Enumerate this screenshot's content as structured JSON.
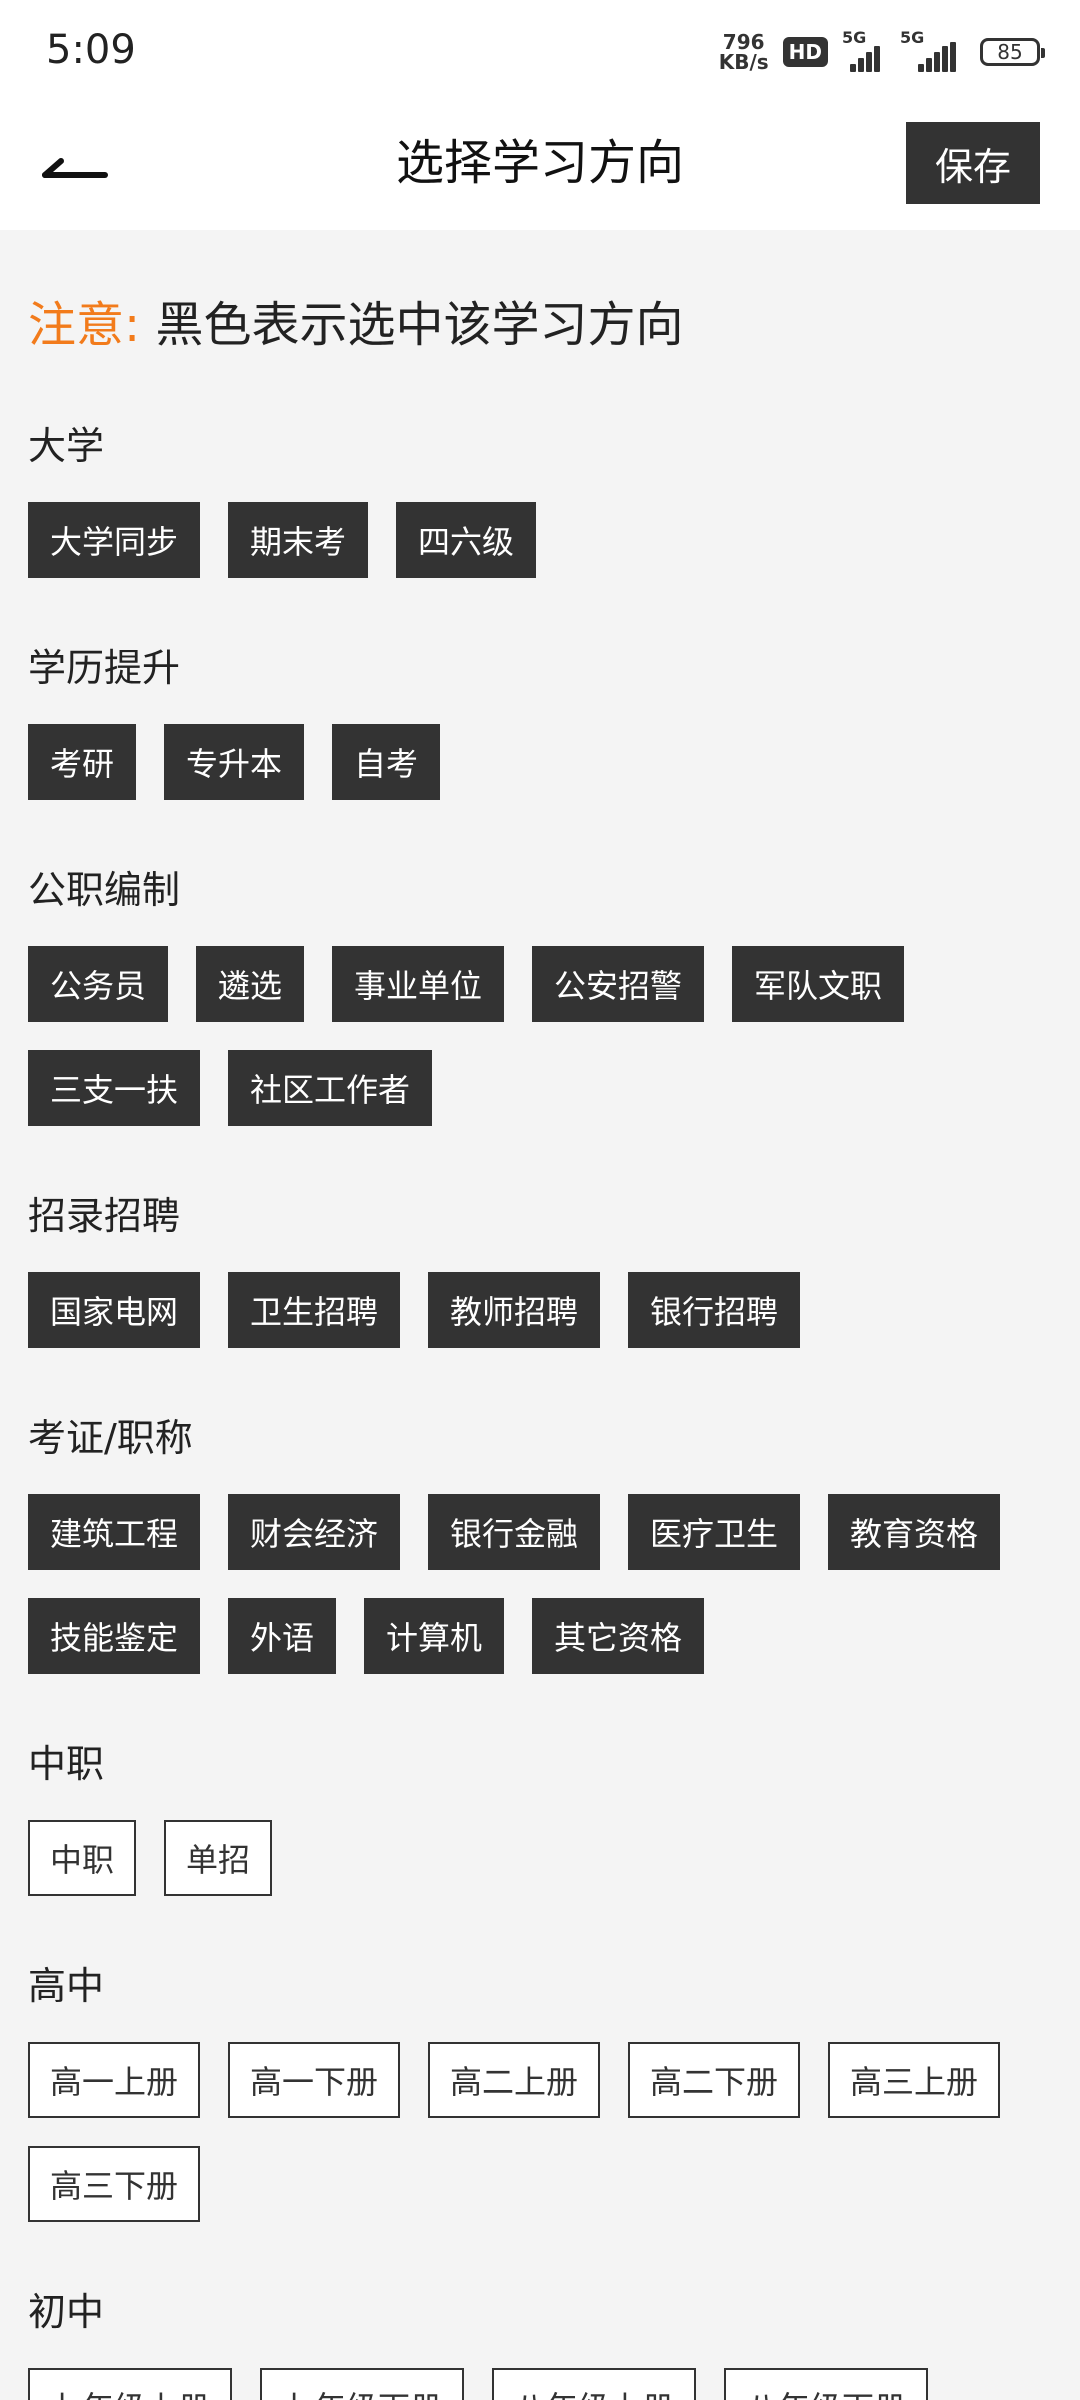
{
  "status": {
    "time": "5:09",
    "net_speed_value": "796",
    "net_speed_unit": "KB/s",
    "hd": "HD",
    "signal1_label": "5G",
    "signal2_label": "5G",
    "battery": "85"
  },
  "header": {
    "title": "选择学习方向",
    "save_label": "保存"
  },
  "notice": {
    "label": "注意:",
    "text": "黑色表示选中该学习方向"
  },
  "colors": {
    "selected_bg": "#333333",
    "selected_text": "#ffffff",
    "unselected_bg": "#ffffff",
    "accent": "#f27b1b",
    "page_bg": "#f4f4f4"
  },
  "sections": [
    {
      "title": "大学",
      "chips": [
        {
          "label": "大学同步",
          "selected": true
        },
        {
          "label": "期末考",
          "selected": true
        },
        {
          "label": "四六级",
          "selected": true
        }
      ]
    },
    {
      "title": "学历提升",
      "chips": [
        {
          "label": "考研",
          "selected": true
        },
        {
          "label": "专升本",
          "selected": true
        },
        {
          "label": "自考",
          "selected": true
        }
      ]
    },
    {
      "title": "公职编制",
      "chips": [
        {
          "label": "公务员",
          "selected": true
        },
        {
          "label": "遴选",
          "selected": true
        },
        {
          "label": "事业单位",
          "selected": true
        },
        {
          "label": "公安招警",
          "selected": true
        },
        {
          "label": "军队文职",
          "selected": true
        },
        {
          "label": "三支一扶",
          "selected": true
        },
        {
          "label": "社区工作者",
          "selected": true
        }
      ]
    },
    {
      "title": "招录招聘",
      "chips": [
        {
          "label": "国家电网",
          "selected": true
        },
        {
          "label": "卫生招聘",
          "selected": true
        },
        {
          "label": "教师招聘",
          "selected": true
        },
        {
          "label": "银行招聘",
          "selected": true
        }
      ]
    },
    {
      "title": "考证/职称",
      "chips": [
        {
          "label": "建筑工程",
          "selected": true
        },
        {
          "label": "财会经济",
          "selected": true
        },
        {
          "label": "银行金融",
          "selected": true
        },
        {
          "label": "医疗卫生",
          "selected": true
        },
        {
          "label": "教育资格",
          "selected": true
        },
        {
          "label": "技能鉴定",
          "selected": true
        },
        {
          "label": "外语",
          "selected": true
        },
        {
          "label": "计算机",
          "selected": true
        },
        {
          "label": "其它资格",
          "selected": true
        }
      ]
    },
    {
      "title": "中职",
      "chips": [
        {
          "label": "中职",
          "selected": false
        },
        {
          "label": "单招",
          "selected": false
        }
      ]
    },
    {
      "title": "高中",
      "chips": [
        {
          "label": "高一上册",
          "selected": false
        },
        {
          "label": "高一下册",
          "selected": false
        },
        {
          "label": "高二上册",
          "selected": false
        },
        {
          "label": "高二下册",
          "selected": false
        },
        {
          "label": "高三上册",
          "selected": false
        },
        {
          "label": "高三下册",
          "selected": false
        }
      ]
    },
    {
      "title": "初中",
      "chips": [
        {
          "label": "七年级上册",
          "selected": false
        },
        {
          "label": "七年级下册",
          "selected": false
        },
        {
          "label": "八年级上册",
          "selected": false
        },
        {
          "label": "八年级下册",
          "selected": false
        }
      ]
    }
  ]
}
